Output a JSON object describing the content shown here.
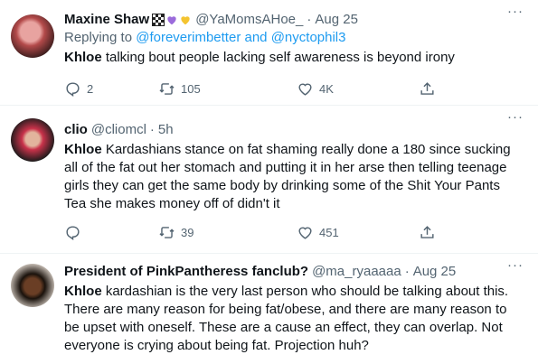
{
  "tweets": [
    {
      "name": "Maxine Shaw",
      "handle": "@YaMomsAHoe_",
      "time": "Aug 25",
      "replying_to_label": "Replying to",
      "replying_user1": "@foreverimbetter",
      "replying_and": "and",
      "replying_user2": "@nyctophil3",
      "bold": "Khloe",
      "text": " talking bout people lacking self awareness is beyond irony",
      "replies": "2",
      "retweets": "105",
      "likes": "4K"
    },
    {
      "name": "clio",
      "handle": "@cliomcl",
      "time": "5h",
      "bold": "Khloe",
      "text": " Kardashians stance on fat shaming really done a 180 since sucking all of the fat out her stomach and putting it in her arse then telling teenage girls they can get the same body by drinking some of the Shit Your Pants Tea she makes money off of didn't it",
      "replies": "",
      "retweets": "39",
      "likes": "451"
    },
    {
      "name": "President of PinkPantheress fanclub?",
      "handle": "@ma_ryaaaaa",
      "time": "Aug 25",
      "bold": "Khloe",
      "text": " kardashian is the very last person who should be talking about this. There are many reason for being fat/obese, and there are many reason to be upset with oneself. These are a cause an effect, they can overlap. Not everyone is crying about being fat. Projection huh?"
    }
  ],
  "separator": "·",
  "more": "···",
  "colors": {
    "link": "#1d9bf0",
    "muted": "#536471",
    "heart_purple": "#9b6bdb",
    "heart_yellow": "#f4c430"
  },
  "icons": [
    "flag-icon",
    "purple-heart-icon",
    "yellow-heart-icon",
    "more-icon",
    "reply-icon",
    "retweet-icon",
    "like-icon",
    "share-icon"
  ]
}
